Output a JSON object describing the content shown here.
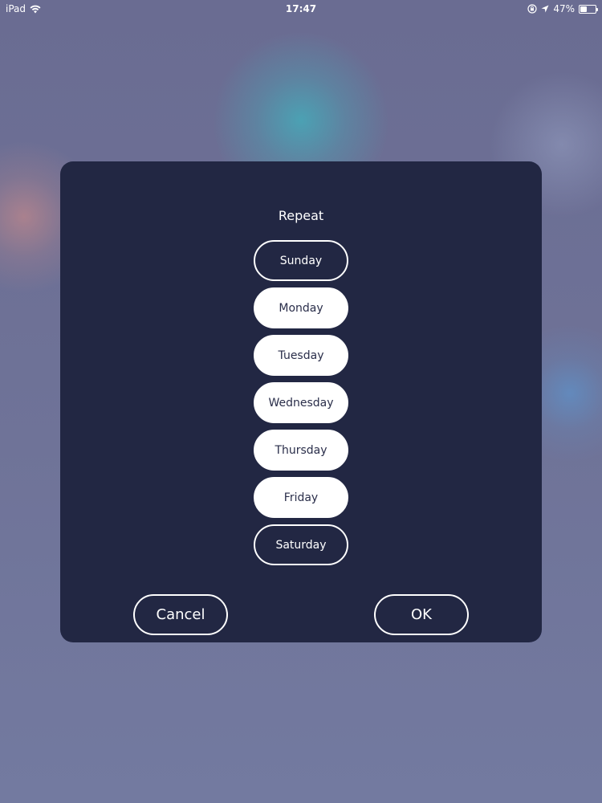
{
  "status_bar": {
    "device": "iPad",
    "time": "17:47",
    "battery_percent": "47%",
    "battery_level": 0.47,
    "icons": [
      "wifi-icon",
      "lock-rotation-icon",
      "location-arrow-icon",
      "battery-icon"
    ]
  },
  "dialog": {
    "title": "Repeat",
    "days": [
      {
        "label": "Sunday",
        "selected": false
      },
      {
        "label": "Monday",
        "selected": true
      },
      {
        "label": "Tuesday",
        "selected": true
      },
      {
        "label": "Wednesday",
        "selected": true
      },
      {
        "label": "Thursday",
        "selected": true
      },
      {
        "label": "Friday",
        "selected": true
      },
      {
        "label": "Saturday",
        "selected": false
      }
    ],
    "cancel_label": "Cancel",
    "ok_label": "OK"
  },
  "colors": {
    "dialog_background": "#222743",
    "selected_pill": "#ffffff",
    "selected_text": "#2a2e4a",
    "backdrop": "#6b6f97"
  }
}
